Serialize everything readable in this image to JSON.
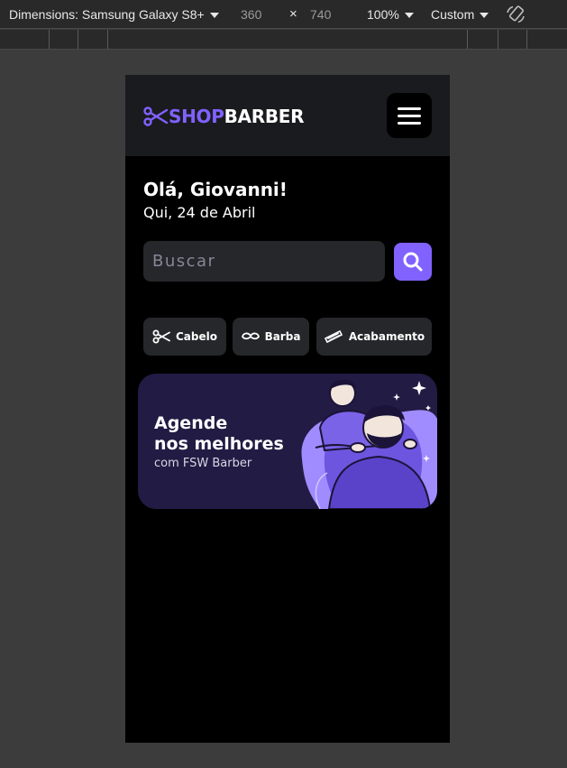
{
  "devtools": {
    "dimensions_label": "Dimensions: Samsung Galaxy S8+",
    "width_value": "360",
    "times_symbol": "×",
    "height_value": "740",
    "zoom": "100%",
    "throttle": "Custom",
    "rotate_icon": "rotate-icon"
  },
  "app": {
    "logo_part1": "SHOP",
    "logo_part2": "BARBER",
    "greeting": "Olá, Giovanni!",
    "date": "Qui, 24 de Abril",
    "search_placeholder": "Buscar",
    "quick_search": [
      {
        "label": "Cabelo",
        "icon": "scissors-icon"
      },
      {
        "label": "Barba",
        "icon": "mustache-icon"
      },
      {
        "label": "Acabamento",
        "icon": "razor-icon"
      }
    ],
    "banner": {
      "title_line1": "Agende",
      "title_line2": "nos melhores",
      "subtitle": "com FSW Barber"
    },
    "colors": {
      "primary": "#8162ff",
      "background": "#000000",
      "surface": "#1a1b1f",
      "card": "#26272b",
      "banner": "#221b43"
    }
  }
}
